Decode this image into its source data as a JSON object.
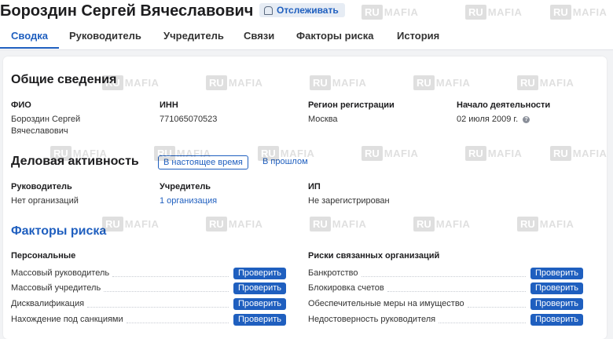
{
  "header": {
    "person_name": "Бороздин Сергей Вячеславович",
    "follow_label": "Отслеживать"
  },
  "tabs": [
    {
      "label": "Сводка"
    },
    {
      "label": "Руководитель"
    },
    {
      "label": "Учредитель"
    },
    {
      "label": "Связи"
    },
    {
      "label": "Факторы риска"
    },
    {
      "label": "История"
    }
  ],
  "general": {
    "title": "Общие сведения",
    "fio_label": "ФИО",
    "fio_line1": "Бороздин Сергей",
    "fio_line2": "Вячеславович",
    "inn_label": "ИНН",
    "inn_value": "771065070523",
    "region_label": "Регион регистрации",
    "region_value": "Москва",
    "start_label": "Начало деятельности",
    "start_value": "02 июля 2009 г."
  },
  "activity": {
    "title": "Деловая активность",
    "now_label": "В настоящее время",
    "past_label": "В прошлом",
    "head_label": "Руководитель",
    "head_value": "Нет организаций",
    "founder_label": "Учредитель",
    "founder_value": "1 организация",
    "ip_label": "ИП",
    "ip_value": "Не зарегистрирован"
  },
  "risk": {
    "title": "Факторы риска",
    "personal_title": "Персональные",
    "related_title": "Риски связанных организаций",
    "check_label": "Проверить",
    "personal": [
      {
        "label": "Массовый руководитель"
      },
      {
        "label": "Массовый учредитель"
      },
      {
        "label": "Дисквалификация"
      },
      {
        "label": "Нахождение под санкциями"
      }
    ],
    "related": [
      {
        "label": "Банкротство"
      },
      {
        "label": "Блокировка счетов"
      },
      {
        "label": "Обеспечительные меры на имущество"
      },
      {
        "label": "Недостоверность руководителя"
      }
    ]
  },
  "watermark": {
    "ru": "RU",
    "mafia": "MAFIA"
  },
  "colors": {
    "accent": "#1f5fbf",
    "background": "#f2f3f5"
  }
}
